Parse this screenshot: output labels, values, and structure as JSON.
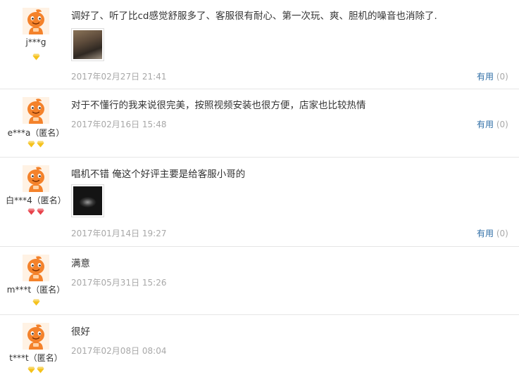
{
  "reviews": [
    {
      "user": "j***g",
      "content": "调好了、听了比cd感觉舒服多了、客服很有耐心、第一次玩、爽、胆机的噪音也消除了.",
      "date": "2017年02月27日 21:41",
      "useful_label": "有用",
      "useful_count": "(0)",
      "level_icon": "gold-diamond",
      "level_count": 1
    },
    {
      "user": "e***a（匿名）",
      "content": "对于不懂行的我来说很完美，按照视频安装也很方便，店家也比较热情",
      "date": "2017年02月16日 15:48",
      "useful_label": "有用",
      "useful_count": "(0)",
      "level_icon": "gold-diamond",
      "level_count": 2
    },
    {
      "user": "白***4（匿名）",
      "content": "唱机不错 俺这个好评主要是给客服小哥的",
      "date": "2017年01月14日 19:27",
      "useful_label": "有用",
      "useful_count": "(0)",
      "level_icon": "red-diamond",
      "level_count": 2
    },
    {
      "user": "m***t（匿名）",
      "content": "满意",
      "date": "2017年05月31日 15:26",
      "level_icon": "gold-diamond",
      "level_count": 1
    },
    {
      "user": "t***t（匿名）",
      "content": "很好",
      "date": "2017年02月08日 08:04",
      "level_icon": "gold-diamond",
      "level_count": 2
    }
  ],
  "colors": {
    "avatar_orange": "#f4822b",
    "gold_diamond": "#f5c21b",
    "red_diamond": "#e8424a",
    "useful_link": "#2f6ea6",
    "meta_gray": "#a8a8a8",
    "divider": "#e6e6e6"
  }
}
